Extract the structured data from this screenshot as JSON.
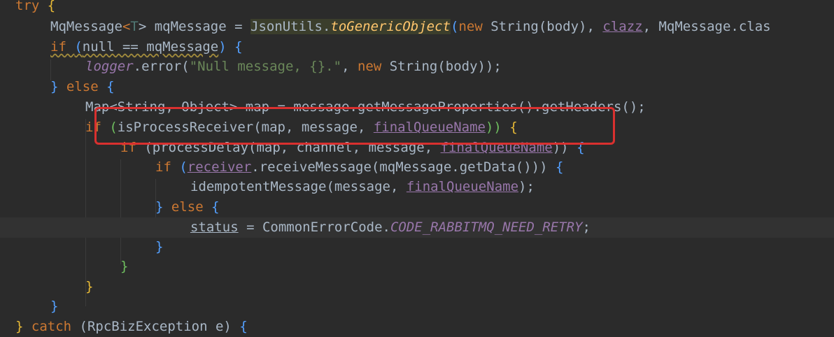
{
  "editor": {
    "lines": [
      {
        "tokens": [
          "try ",
          "{"
        ]
      },
      {
        "tokens": [
          "MqMessage",
          "<",
          "T",
          "> mqMessage = ",
          "JsonUtils.",
          "toGenericObject",
          "(",
          "new ",
          "String(body), ",
          "clazz",
          ", MqMessage.clas"
        ]
      },
      {
        "tokens": [
          "if ",
          "(",
          "null == mqMessage",
          ") ",
          "{"
        ]
      },
      {
        "tokens": [
          "logger",
          ".error(",
          "\"Null message, {}.\"",
          ", ",
          "new ",
          "String(body));"
        ]
      },
      {
        "tokens": [
          "} ",
          "else ",
          "{"
        ]
      },
      {
        "tokens": [
          "Map<String, Object> map = message.getMessageProperties().getHeaders();"
        ]
      },
      {
        "tokens": [
          "if ",
          "(",
          "isProcessReceiver(map, message, ",
          "finalQueueName",
          ")) ",
          "{"
        ]
      },
      {
        "tokens": [
          "if ",
          "(processDelay(map, channel, message, ",
          "finalQueueName",
          ")) ",
          "{"
        ]
      },
      {
        "tokens": [
          "if ",
          "(",
          "receiver",
          ".receiveMessage(mqMessage.getData())) ",
          "{"
        ]
      },
      {
        "tokens": [
          "idempotentMessage(message, ",
          "finalQueueName",
          ");"
        ]
      },
      {
        "tokens": [
          "} ",
          "else ",
          "{"
        ]
      },
      {
        "tokens": [
          "status",
          " = CommonErrorCode.",
          "CODE_RABBITMQ_NEED_RETRY",
          ";"
        ]
      },
      {
        "tokens": [
          "}"
        ]
      },
      {
        "tokens": [
          "}"
        ]
      },
      {
        "tokens": [
          "}"
        ]
      },
      {
        "tokens": [
          "}"
        ]
      },
      {
        "tokens": [
          "} ",
          "catch ",
          "(RpcBizException e) ",
          "{"
        ]
      }
    ]
  },
  "annotation": {
    "label": "highlight-box"
  }
}
